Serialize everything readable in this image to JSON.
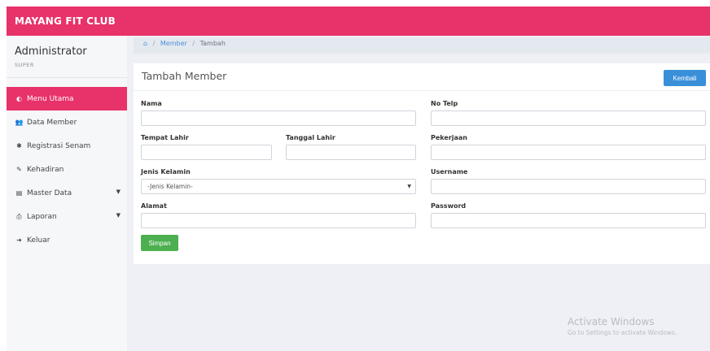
{
  "header": {
    "brand": "MAYANG FIT CLUB"
  },
  "sidebar": {
    "user_name": "Administrator",
    "user_role": "SUPER",
    "items": [
      {
        "label": "Menu Utama",
        "icon": "dashboard-icon",
        "glyph": "◐",
        "active": true,
        "dropdown": false
      },
      {
        "label": "Data Member",
        "icon": "users-icon",
        "glyph": "👥",
        "active": false,
        "dropdown": false
      },
      {
        "label": "Registrasi Senam",
        "icon": "gear-icon",
        "glyph": "✱",
        "active": false,
        "dropdown": false
      },
      {
        "label": "Kehadiran",
        "icon": "edit-icon",
        "glyph": "✎",
        "active": false,
        "dropdown": false
      },
      {
        "label": "Master Data",
        "icon": "database-icon",
        "glyph": "▤",
        "active": false,
        "dropdown": true
      },
      {
        "label": "Laporan",
        "icon": "print-icon",
        "glyph": "⎙",
        "active": false,
        "dropdown": true
      },
      {
        "label": "Keluar",
        "icon": "sign-out-icon",
        "glyph": "➜",
        "active": false,
        "dropdown": false
      }
    ]
  },
  "breadcrumb": {
    "home_icon": "home-icon",
    "home_glyph": "⌂",
    "link": "Member",
    "current": "Tambah",
    "separator": "/"
  },
  "card": {
    "title": "Tambah Member",
    "back_label": "Kembali"
  },
  "form": {
    "nama_label": "Nama",
    "no_telp_label": "No Telp",
    "tempat_lahir_label": "Tempat Lahir",
    "tanggal_lahir_label": "Tanggal Lahir",
    "pekerjaan_label": "Pekerjaan",
    "jenis_kelamin_label": "Jenis Kelamin",
    "jenis_kelamin_value": "-Jenis Kelamin-",
    "username_label": "Username",
    "alamat_label": "Alamat",
    "password_label": "Password",
    "save_label": "Simpan"
  },
  "watermark": {
    "line1": "Activate Windows",
    "line2": "Go to Settings to activate Windows."
  },
  "colors": {
    "brand": "#e8326a",
    "primary": "#3a8fd9",
    "success": "#4caf50"
  }
}
